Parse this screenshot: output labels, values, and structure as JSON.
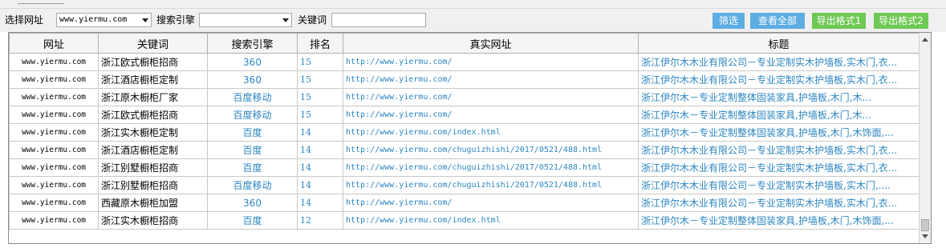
{
  "toolbar": {
    "site_label": "选择网址",
    "site_value": "www.yiermu.com",
    "engine_label": "搜索引擎",
    "engine_value": "",
    "keyword_label": "关键词",
    "keyword_value": "",
    "filter_button": "筛选",
    "view_all_button": "查看全部",
    "export1_button": "导出格式1",
    "export2_button": "导出格式2"
  },
  "table": {
    "columns": [
      "网址",
      "关键词",
      "搜索引擎",
      "排名",
      "真实网址",
      "标题"
    ],
    "rows": [
      {
        "site": "www.yiermu.com",
        "keyword": "浙江欧式橱柜招商",
        "engine": "360",
        "rank": "15",
        "real_url": "http://www.yiermu.com/",
        "title": "浙江伊尔木木业有限公司－专业定制实木护墙板,实木门,衣..."
      },
      {
        "site": "www.yiermu.com",
        "keyword": "浙江酒店橱柜定制",
        "engine": "360",
        "rank": "15",
        "real_url": "http://www.yiermu.com/",
        "title": "浙江伊尔木木业有限公司－专业定制实木护墙板,实木门,衣..."
      },
      {
        "site": "www.yiermu.com",
        "keyword": "浙江原木橱柜厂家",
        "engine": "百度移动",
        "rank": "15",
        "real_url": "http://www.yiermu.com/",
        "title": "浙江伊尔木－专业定制整体固装家具,护墙板,木门,木..."
      },
      {
        "site": "www.yiermu.com",
        "keyword": "浙江欧式橱柜招商",
        "engine": "百度移动",
        "rank": "15",
        "real_url": "http://www.yiermu.com/",
        "title": "浙江伊尔木－专业定制整体固装家具,护墙板,木门,木..."
      },
      {
        "site": "www.yiermu.com",
        "keyword": "浙江实木橱柜定制",
        "engine": "百度",
        "rank": "14",
        "real_url": "http://www.yiermu.com/index.html",
        "title": "浙江伊尔木－专业定制整体固装家具,护墙板,木门,木饰面,..."
      },
      {
        "site": "www.yiermu.com",
        "keyword": "浙江酒店橱柜定制",
        "engine": "百度",
        "rank": "14",
        "real_url": "http://www.yiermu.com/chuguizhishi/2017/0521/488.html",
        "title": "浙江伊尔木木业有限公司－专业定制实木护墙板,实木门,衣..."
      },
      {
        "site": "www.yiermu.com",
        "keyword": "浙江别墅橱柜招商",
        "engine": "百度",
        "rank": "14",
        "real_url": "http://www.yiermu.com/chuguizhishi/2017/0521/488.html",
        "title": "浙江伊尔木木业有限公司－专业定制实木护墙板,实木门,衣..."
      },
      {
        "site": "www.yiermu.com",
        "keyword": "浙江别墅橱柜招商",
        "engine": "百度移动",
        "rank": "14",
        "real_url": "http://www.yiermu.com/chuguizhishi/2017/0521/488.html",
        "title": "浙江伊尔木木业有限公司－专业定制实木护墙板,实木门,...."
      },
      {
        "site": "www.yiermu.com",
        "keyword": "西藏原木橱柜加盟",
        "engine": "360",
        "rank": "14",
        "real_url": "http://www.yiermu.com/",
        "title": "浙江伊尔木木业有限公司－专业定制实木护墙板,实木门,衣..."
      },
      {
        "site": "www.yiermu.com",
        "keyword": "浙江实木橱柜招商",
        "engine": "百度",
        "rank": "12",
        "real_url": "http://www.yiermu.com/index.html",
        "title": "浙江伊尔木－专业定制整体固装家具,护墙板,木门,木饰面,..."
      }
    ]
  },
  "colors": {
    "link": "#2e86c1",
    "button_blue": "#5dade2",
    "button_green": "#6ec855"
  }
}
